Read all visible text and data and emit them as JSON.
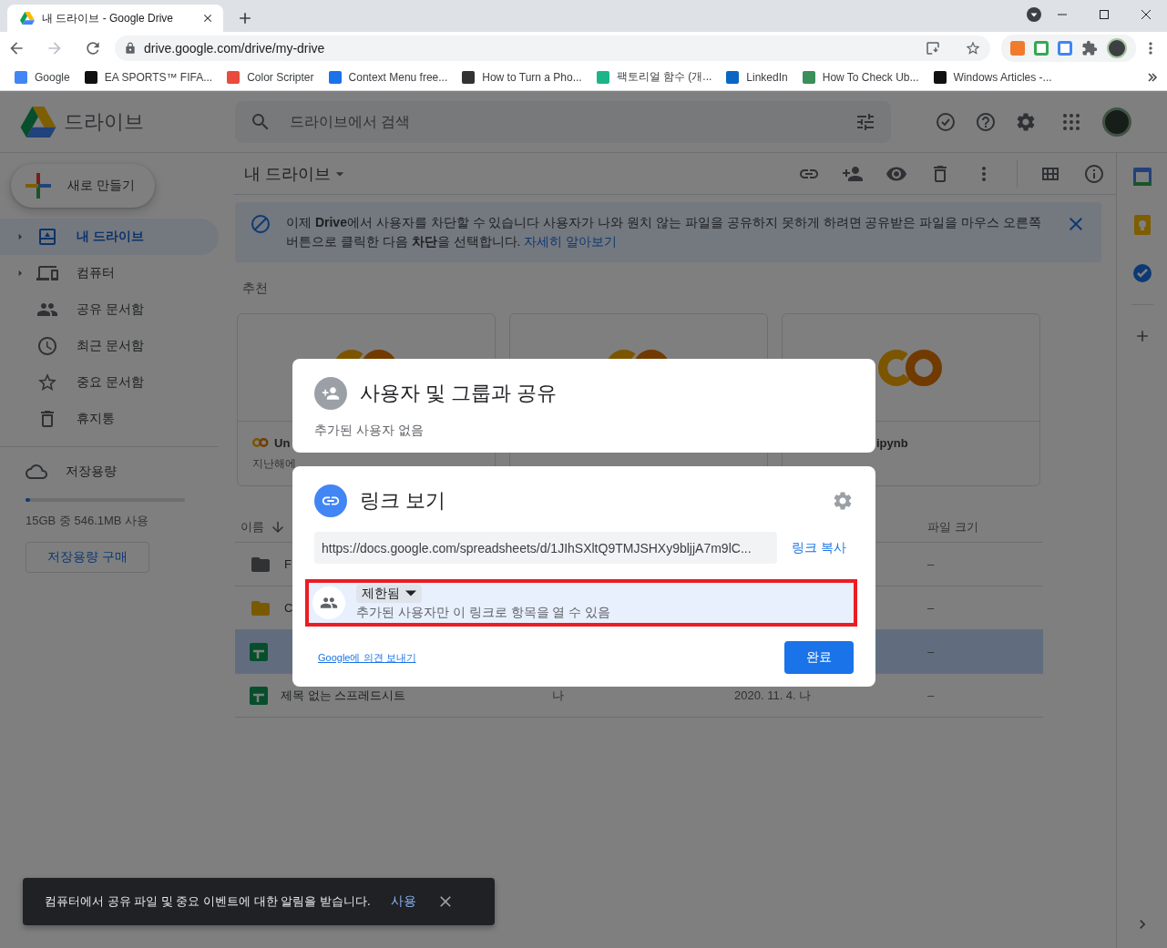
{
  "browser": {
    "tab_title": "내 드라이브 - Google Drive",
    "url": "drive.google.com/drive/my-drive",
    "bookmarks": [
      {
        "label": "Google"
      },
      {
        "label": "EA SPORTS™ FIFA..."
      },
      {
        "label": "Color Scripter"
      },
      {
        "label": "Context Menu free..."
      },
      {
        "label": "How to Turn a Pho..."
      },
      {
        "label": "팩토리얼 함수 (개..."
      },
      {
        "label": "LinkedIn"
      },
      {
        "label": "How To Check Ub..."
      },
      {
        "label": "Windows Articles -..."
      }
    ]
  },
  "drive": {
    "app_name": "드라이브",
    "search": {
      "placeholder": "드라이브에서 검색"
    },
    "new_button": "새로 만들기",
    "nav": [
      {
        "label": "내 드라이브",
        "selected": true,
        "expandable": true
      },
      {
        "label": "컴퓨터",
        "selected": false,
        "expandable": true
      },
      {
        "label": "공유 문서함",
        "selected": false,
        "expandable": false
      },
      {
        "label": "최근 문서함",
        "selected": false,
        "expandable": false
      },
      {
        "label": "중요 문서함",
        "selected": false,
        "expandable": false
      },
      {
        "label": "휴지통",
        "selected": false,
        "expandable": false
      }
    ],
    "storage": {
      "label": "저장용량",
      "level": 0.03,
      "usage": "15GB 중 546.1MB 사용",
      "buy_button": "저장용량 구매"
    },
    "breadcrumb": "내 드라이브",
    "banner": {
      "text": "이제 **Drive**에서 사용자를 차단할 수 있습니다 사용자가 나와 원치 않는 파일을 공유하지 못하게 하려면 공유받은 파일을 마우스 오른쪽 버튼으로 클릭한 다음 **차단**을 선택합니다.",
      "link": "자세히 알아보기"
    },
    "suggested": {
      "title": "추천",
      "cards": [
        {
          "kind": "colab",
          "name": "Un",
          "modified": "지난해에"
        },
        {
          "kind": "colab"
        },
        {
          "kind": "colab",
          "name": "ipynb"
        }
      ]
    },
    "list": {
      "columns": [
        {
          "label": "이름"
        },
        {
          "label": "파일 크기"
        }
      ],
      "rows": [
        {
          "kind": "folder",
          "color": "#303234",
          "name": "F",
          "size": "–",
          "selected": false
        },
        {
          "kind": "folder",
          "color": "#7a5a00",
          "name": "C",
          "size": "–",
          "selected": false
        },
        {
          "kind": "sheet",
          "size": "–",
          "selected": true
        },
        {
          "kind": "sheet",
          "name": "제목 없는 스프레드시트",
          "owner": "나",
          "modified": "2020. 11. 4. 나",
          "size": "–",
          "selected": false
        }
      ]
    }
  },
  "share_dialog": {
    "title": "사용자 및 그룹과 공유",
    "subtitle": "추가된 사용자 없음"
  },
  "link_dialog": {
    "title": "링크 보기",
    "url": "https://docs.google.com/spreadsheets/d/1JIhSXltQ9TMJSHXy9bljjA7m9lC...",
    "copy_link": "링크 복사",
    "access": {
      "value": "제한됨",
      "description": "추가된 사용자만 이 링크로 항목을 열 수 있음"
    },
    "feedback_link": "Google에 의견 보내기",
    "done_button": "완료"
  },
  "snackbar": {
    "text": "컴퓨터에서 공유 파일 및 중요 이벤트에 대한 알림을 받습니다.",
    "action": "사용"
  }
}
